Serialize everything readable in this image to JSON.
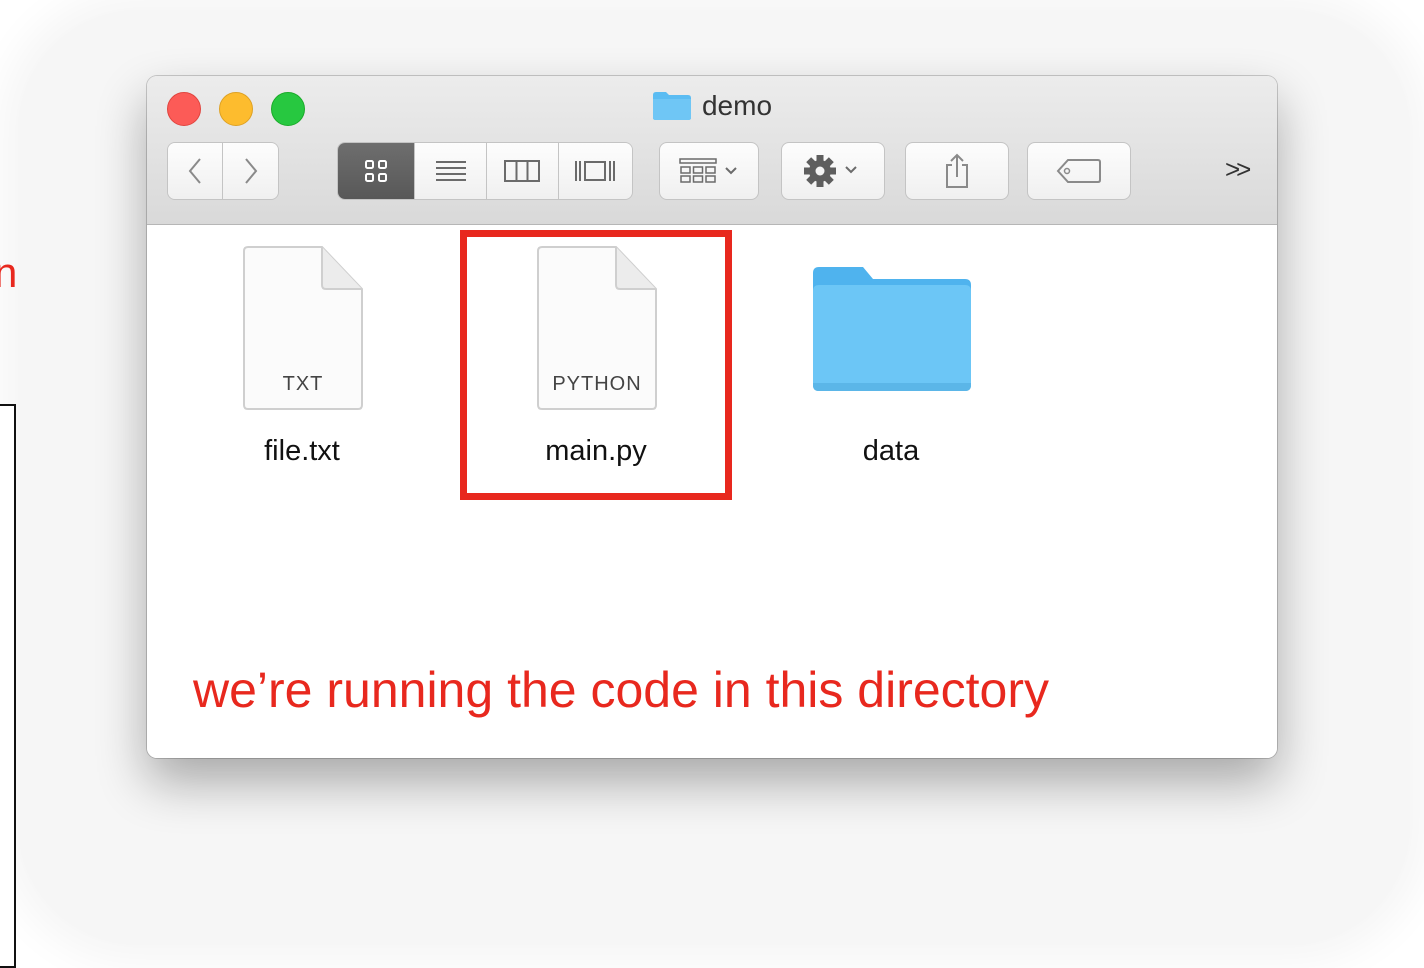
{
  "window": {
    "title": "demo",
    "toolbar": {
      "back_icon": "chevron-left-icon",
      "forward_icon": "chevron-right-icon",
      "view_modes": [
        "icon-view",
        "list-view",
        "column-view",
        "gallery-view"
      ],
      "active_view": "icon-view",
      "group_icon": "arrange-grid-icon",
      "action_icon": "gear-icon",
      "share_icon": "share-icon",
      "tag_icon": "tag-icon",
      "overflow_label": ">>"
    }
  },
  "files": [
    {
      "name": "file.txt",
      "kind_tag": "TXT",
      "icon": "text-document-icon"
    },
    {
      "name": "main.py",
      "kind_tag": "PYTHON",
      "icon": "python-document-icon",
      "highlighted": true
    },
    {
      "name": "data",
      "kind_tag": "",
      "icon": "folder-icon"
    }
  ],
  "annotation": {
    "caption": "we’re running the code in this directory",
    "left_fragment": "n",
    "color": "#e8281e"
  },
  "colors": {
    "accent_red": "#e8281e",
    "folder_blue": "#5bbcf2",
    "traffic_close": "#fc5b57",
    "traffic_min": "#fdbc2e",
    "traffic_max": "#27c840"
  }
}
